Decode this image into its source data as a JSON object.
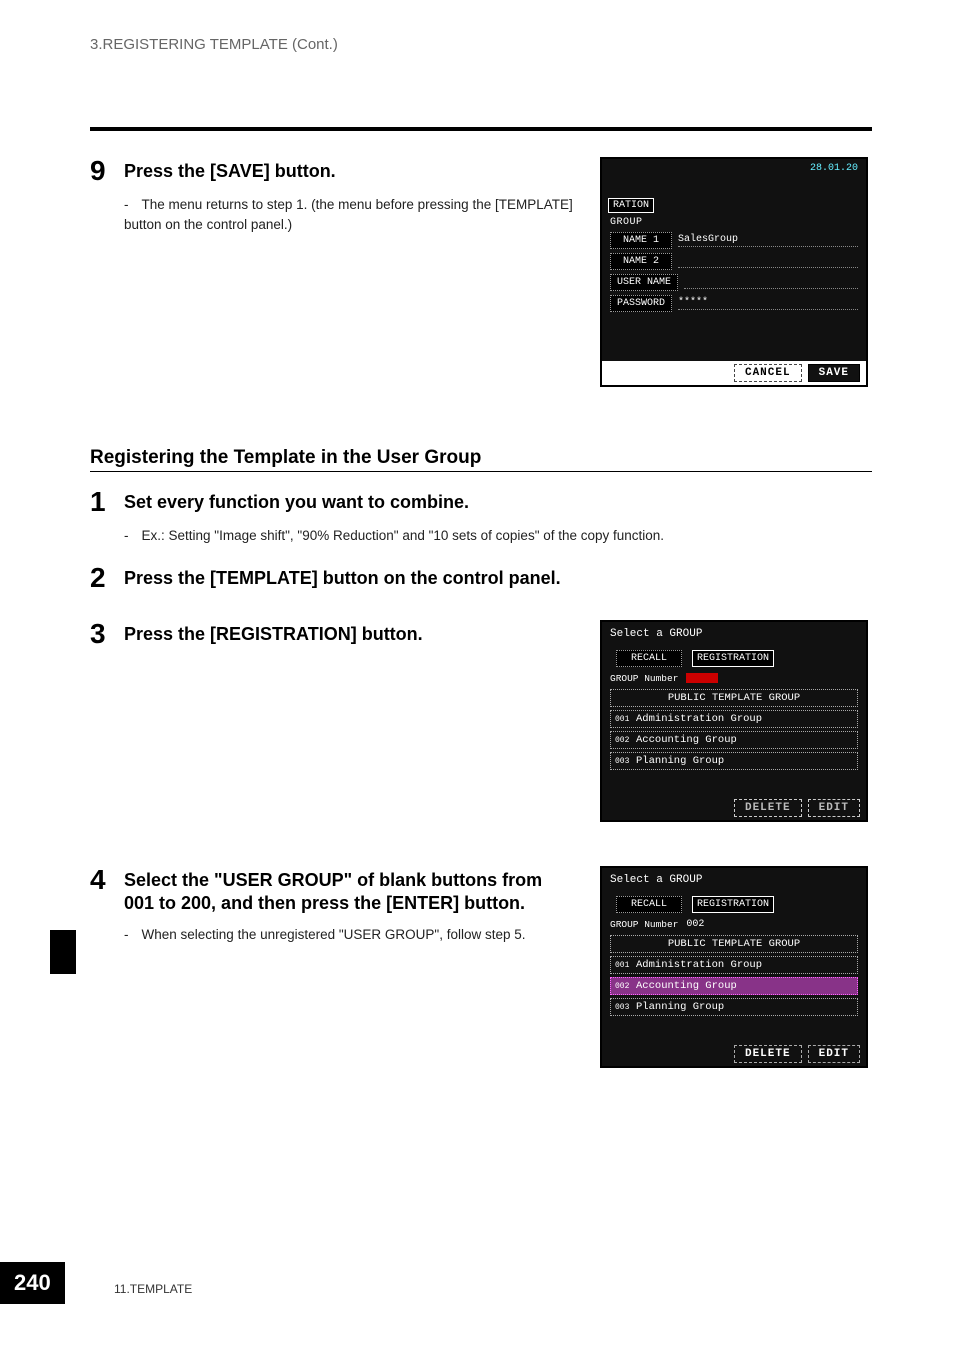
{
  "header": {
    "running": "3.REGISTERING TEMPLATE (Cont.)"
  },
  "step9": {
    "num": "9",
    "title": "Press the [SAVE] button.",
    "body": "The menu returns to step 1. (the menu before pressing the [TEMPLATE] button on the control panel.)"
  },
  "screen1": {
    "date": "28.01.20",
    "tab": "RATION",
    "grouplabel": "GROUP",
    "rows": {
      "name1_label": "NAME 1",
      "name1_value": "SalesGroup",
      "name2_label": "NAME 2",
      "name2_value": "",
      "username_label": "USER NAME",
      "username_value": "",
      "password_label": "PASSWORD",
      "password_value": "*****"
    },
    "cancel": "CANCEL",
    "save": "SAVE"
  },
  "section": {
    "title": "Registering the Template in the User Group"
  },
  "step1": {
    "num": "1",
    "title": "Set every function you want to combine.",
    "body": "Ex.: Setting \"Image shift\", \"90% Reduction\" and \"10 sets of copies\" of the copy function."
  },
  "step2": {
    "num": "2",
    "title": "Press the [TEMPLATE] button on the control panel."
  },
  "step3": {
    "num": "3",
    "title": "Press the [REGISTRATION] button."
  },
  "screen2": {
    "heading": "Select a GROUP",
    "recall": "RECALL",
    "registration": "REGISTRATION",
    "groupnum_label": "GROUP Number",
    "groupnum_value": "",
    "rows": {
      "r0": "PUBLIC TEMPLATE GROUP",
      "r1_num": "001",
      "r1": "Administration Group",
      "r2_num": "002",
      "r2": "Accounting Group",
      "r3_num": "003",
      "r3": "Planning Group"
    },
    "delete": "DELETE",
    "edit": "EDIT"
  },
  "step4": {
    "num": "4",
    "title": "Select the \"USER GROUP\" of blank buttons from 001 to 200, and then press the [ENTER] button.",
    "body": "When selecting the unregistered \"USER GROUP\", follow step 5."
  },
  "screen3": {
    "heading": "Select a GROUP",
    "recall": "RECALL",
    "registration": "REGISTRATION",
    "groupnum_label": "GROUP Number",
    "groupnum_value": "002",
    "rows": {
      "r0": "PUBLIC TEMPLATE GROUP",
      "r1_num": "001",
      "r1": "Administration Group",
      "r2_num": "002",
      "r2": "Accounting Group",
      "r3_num": "003",
      "r3": "Planning Group"
    },
    "delete": "DELETE",
    "edit": "EDIT"
  },
  "footer": {
    "pagenum": "240",
    "chapter": "11.TEMPLATE"
  }
}
